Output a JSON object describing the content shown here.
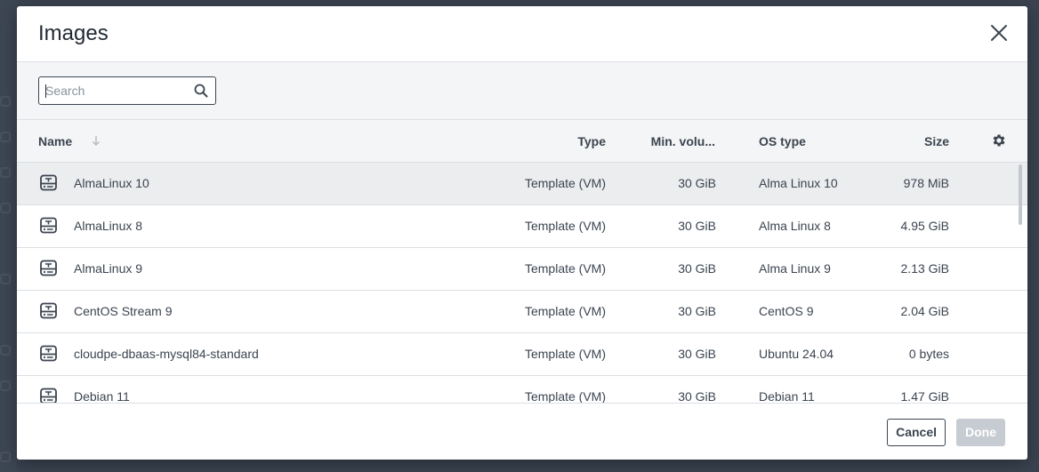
{
  "dialog": {
    "title": "Images",
    "close_icon": "close-icon"
  },
  "search": {
    "placeholder": "Search",
    "value": "",
    "icon": "search-icon"
  },
  "table": {
    "columns": {
      "name": "Name",
      "type": "Type",
      "min_volume": "Min. volu...",
      "os_type": "OS type",
      "size": "Size"
    },
    "sort_icon": "sort-down-arrow-icon",
    "settings_icon": "gear-icon",
    "rows": [
      {
        "name": "AlmaLinux 10",
        "type": "Template (VM)",
        "min_volume": "30 GiB",
        "os_type": "Alma Linux 10",
        "size": "978 MiB",
        "selected": true
      },
      {
        "name": "AlmaLinux 8",
        "type": "Template (VM)",
        "min_volume": "30 GiB",
        "os_type": "Alma Linux 8",
        "size": "4.95 GiB",
        "selected": false
      },
      {
        "name": "AlmaLinux 9",
        "type": "Template (VM)",
        "min_volume": "30 GiB",
        "os_type": "Alma Linux 9",
        "size": "2.13 GiB",
        "selected": false
      },
      {
        "name": "CentOS Stream 9",
        "type": "Template (VM)",
        "min_volume": "30 GiB",
        "os_type": "CentOS 9",
        "size": "2.04 GiB",
        "selected": false
      },
      {
        "name": "cloudpe-dbaas-mysql84-standard",
        "type": "Template (VM)",
        "min_volume": "30 GiB",
        "os_type": "Ubuntu 24.04",
        "size": "0 bytes",
        "selected": false
      },
      {
        "name": "Debian 11",
        "type": "Template (VM)",
        "min_volume": "30 GiB",
        "os_type": "Debian 11",
        "size": "1.47 GiB",
        "selected": false
      }
    ],
    "row_icon": "template-disk-icon"
  },
  "footer": {
    "cancel_label": "Cancel",
    "done_label": "Done"
  },
  "colors": {
    "text": "#3b4450",
    "border": "#dcdfe3",
    "header_bg": "#f4f5f6",
    "selected_row_bg": "#ebedef",
    "disabled_button_bg": "#c7ccd2"
  }
}
